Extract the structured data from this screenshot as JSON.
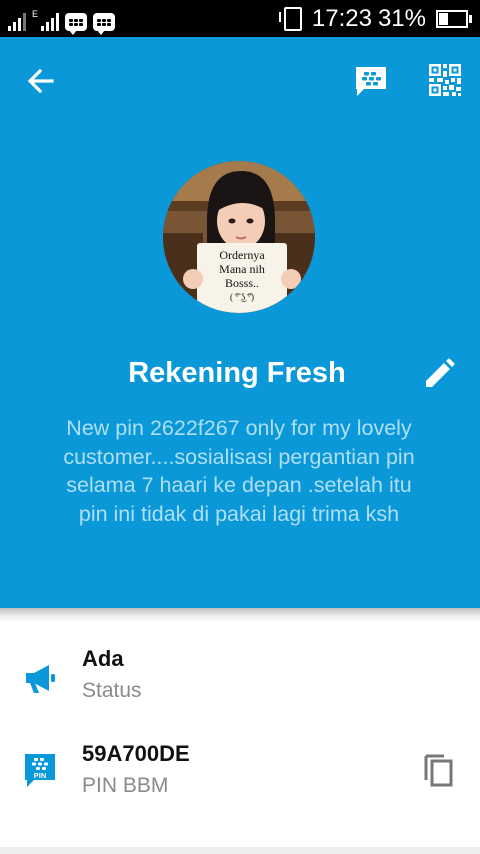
{
  "status_bar": {
    "network_label": "E",
    "time": "17:23",
    "battery_percent": "31%",
    "battery_level": 0.31
  },
  "toolbar": {
    "back_icon": "arrow-left-icon",
    "chat_icon": "bbm-chat-icon",
    "qr_icon": "qr-code-icon"
  },
  "profile": {
    "avatar_caption_lines": [
      "Ordernya",
      "Mana nih",
      "Bosss..",
      "( ͡° ͜ʖ ͡°)"
    ],
    "name": "Rekening Fresh",
    "bio": "New pin 2622f267 only for my lovely customer....sosialisasi pergantian pin selama 7 haari ke depan .setelah itu pin ini tidak di pakai lagi trima ksh"
  },
  "details": [
    {
      "icon": "megaphone-icon",
      "title": "Ada",
      "subtitle": "Status"
    },
    {
      "icon": "bbm-pin-icon",
      "title": "59A700DE",
      "subtitle": "PIN BBM",
      "icon_text": "PIN",
      "action_icon": "copy-icon"
    }
  ],
  "colors": {
    "header_bg": "#0b98d8",
    "bio_text": "#aedff5",
    "icon_blue": "#0b98d8"
  }
}
